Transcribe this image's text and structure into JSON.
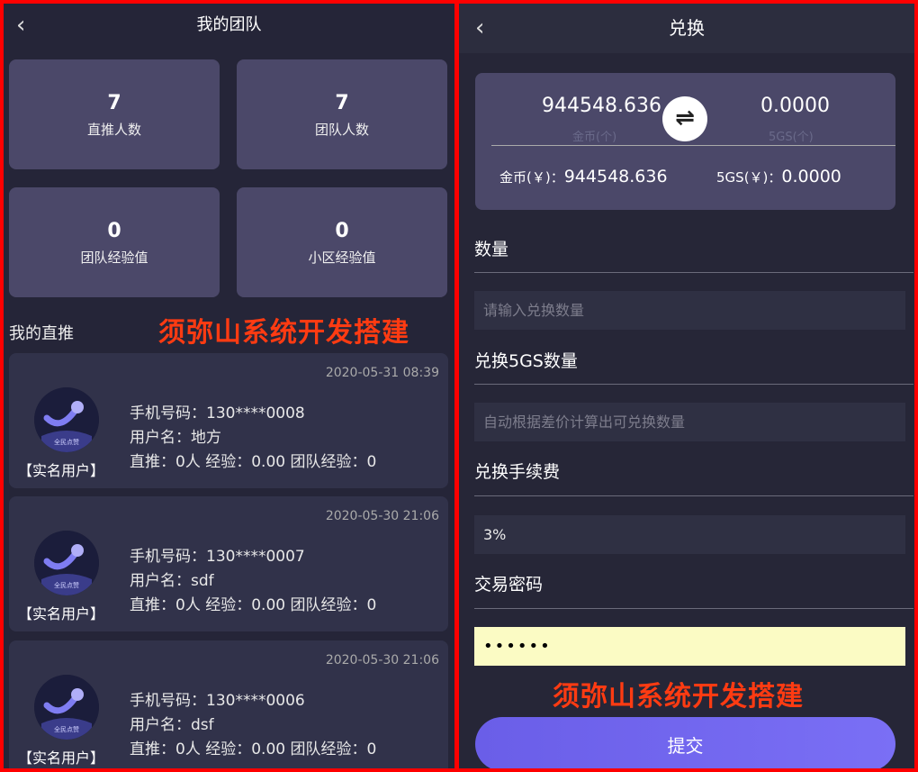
{
  "left": {
    "title": "我的团队",
    "back_icon": "chevron-left-icon",
    "stats": [
      {
        "value": "7",
        "label": "直推人数"
      },
      {
        "value": "7",
        "label": "团队人数"
      },
      {
        "value": "0",
        "label": "团队经验值"
      },
      {
        "value": "0",
        "label": "小区经验值"
      }
    ],
    "section_title": "我的直推",
    "watermark": "须弥山系统开发搭建",
    "members": [
      {
        "date": "2020-05-31 08:39",
        "phone": "手机号码：130****0008",
        "username": "用户名：地方",
        "stats": "直推：0人  经验：0.00  团队经验：0",
        "badge": "【实名用户】",
        "avatar_text": "全民点赞"
      },
      {
        "date": "2020-05-30 21:06",
        "phone": "手机号码：130****0007",
        "username": "用户名：sdf",
        "stats": "直推：0人  经验：0.00  团队经验：0",
        "badge": "【实名用户】",
        "avatar_text": "全民点赞"
      },
      {
        "date": "2020-05-30 21:06",
        "phone": "手机号码：130****0006",
        "username": "用户名：dsf",
        "stats": "直推：0人  经验：0.00  团队经验：0",
        "badge": "【实名用户】",
        "avatar_text": "全民点赞"
      }
    ]
  },
  "right": {
    "title": "兑换",
    "back_icon": "chevron-left-icon",
    "balance": {
      "from_value": "944548.636",
      "from_unit": "金币(个)",
      "to_value": "0.0000",
      "to_unit": "5GS(个)",
      "swap_icon": "swap-arrows-icon",
      "from_rmb_label": "金币(￥)：",
      "from_rmb_value": "944548.636",
      "to_rmb_label": "5GS(￥)：",
      "to_rmb_value": "0.0000"
    },
    "fields": {
      "qty_label": "数量",
      "qty_placeholder": "请输入兑换数量",
      "result_label": "兑换5GS数量",
      "result_placeholder": "自动根据差价计算出可兑换数量",
      "fee_label": "兑换手续费",
      "fee_value": "3%",
      "pwd_label": "交易密码",
      "pwd_value": "••••••"
    },
    "watermark": "须弥山系统开发搭建",
    "submit_label": "提交"
  },
  "colors": {
    "frame": "#ff0000",
    "panel_bg": "#252538",
    "card_bg": "#4b4869",
    "member_bg": "#31324a",
    "watermark": "#ff3b12",
    "submit": "#6a5ee8",
    "password_bg": "#fbfbc4"
  }
}
